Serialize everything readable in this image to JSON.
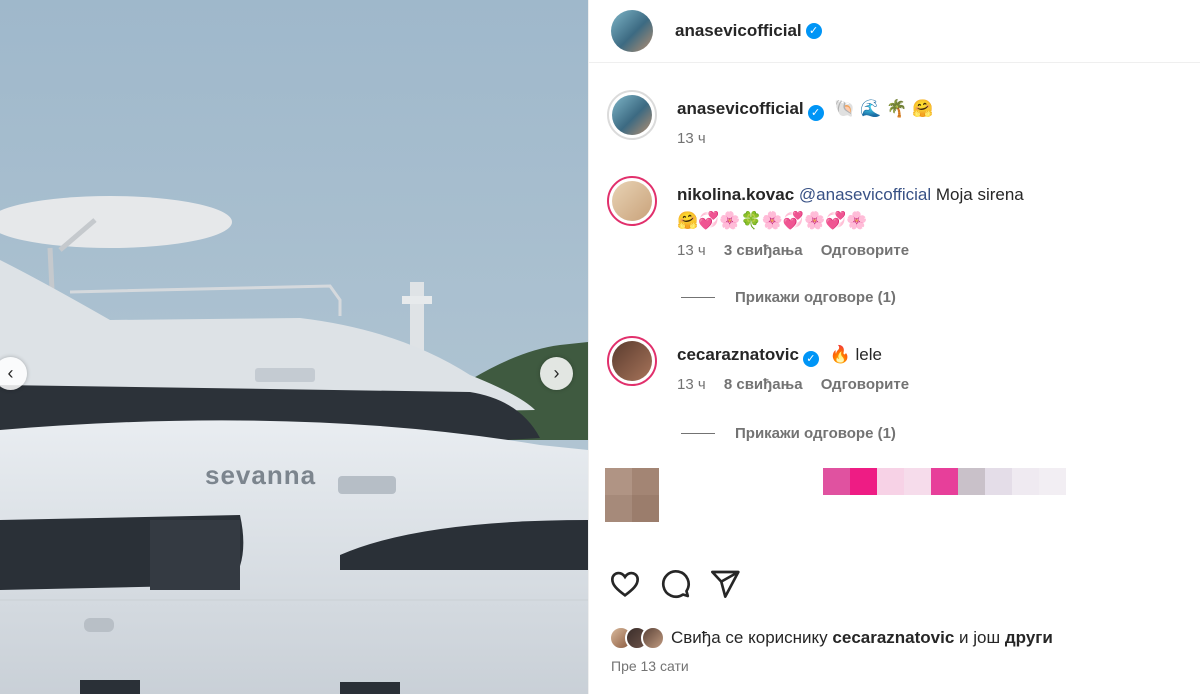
{
  "post": {
    "author": "anasevicofficial",
    "verified_mark": "✓"
  },
  "media": {
    "yacht_name": "sevanna",
    "prev_icon": "chevron-left-icon",
    "next_icon": "chevron-right-icon"
  },
  "caption": {
    "username": "anasevicofficial",
    "text": "🐚 🌊 🌴 🤗",
    "time": "13 ч"
  },
  "comments": [
    {
      "username": "nikolina.kovac",
      "mention": "@anasevicofficial",
      "text": "Moja sirena",
      "emoji_line": "🤗💞🌸🍀🌸💞🌸💞🌸",
      "time": "13 ч",
      "likes": "3 свиђања",
      "reply": "Одговорите",
      "view_replies": "Прикажи одговоре (1)"
    },
    {
      "username": "cecaraznatovic",
      "text": "🔥 lele",
      "time": "13 ч",
      "likes": "8 свиђања",
      "reply": "Одговорите",
      "view_replies": "Прикажи одговоре (1)"
    }
  ],
  "likes_line": {
    "prefix": "Свиђа се кориснику",
    "user": "cecaraznatovic",
    "mid": "и још",
    "others": "други"
  },
  "timestamp": "Пре 13 сати",
  "colors": {
    "verified": "#0095f6",
    "story_ring": "#e1306c",
    "mention": "#385185"
  }
}
